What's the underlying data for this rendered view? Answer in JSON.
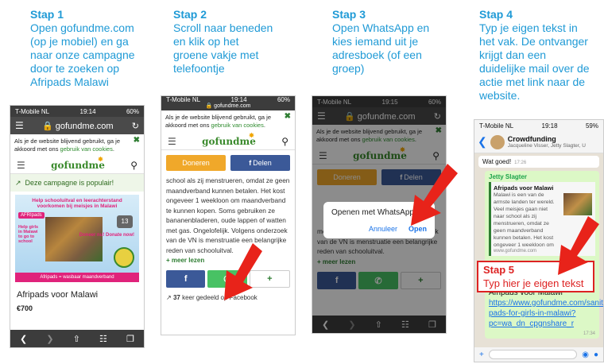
{
  "steps": [
    {
      "num": "Stap 1",
      "text": "Open gofundme.com\n(op je mobiel) en ga\nnaar onze campagne\ndoor te zoeken op\nAfripads Malawi"
    },
    {
      "num": "Stap 2",
      "text": "Scroll naar beneden\nen klik op het\ngroene vakje met\ntelefoontje"
    },
    {
      "num": "Stap 3",
      "text": "Open WhatsApp en\nkies iemand uit je\nadresboek (of een\ngroep)"
    },
    {
      "num": "Stap 4",
      "text": "Typ je eigen tekst in\nhet vak. De ontvanger\nkrijgt dan een\nduidelijke mail over de\nactie met link naar de\nwebsite."
    }
  ],
  "stap5": {
    "num": "Stap 5",
    "text": "Typ hier je eigen tekst"
  },
  "status": {
    "carrier": "T-Mobile NL",
    "time1": "19:14",
    "time2": "19:14",
    "time3": "19:15",
    "time4": "19:18",
    "battery": "60%",
    "battery4": "59%"
  },
  "browser": {
    "url": "gofundme.com",
    "url_small": "gofundme.com"
  },
  "cookie": {
    "text": "Als je de website blijvend gebruikt, ga je akkoord met ons ",
    "link": "gebruik van cookies",
    "end": "."
  },
  "logo": "gofundme",
  "phone1": {
    "popular": "Deze campagne is populair!",
    "banner_title": "Help schooluitval en leerachterstand voorkomen bij meisjes in Malawi",
    "afripads": "AFRIpads",
    "help_text": "Help girls in Malawi to go to school",
    "badge": "13",
    "donate": "Doneer nu! Donate now!",
    "footer": "Afripads = wasbaar maandverband",
    "title": "Afripads voor Malawi",
    "amount": "€700"
  },
  "phone2": {
    "donate_btn": "Doneren",
    "share_btn": "Delen",
    "story": "school als zij menstrueren, omdat ze geen maandverband kunnen betalen. Het kost ongeveer 1 weekloon om maandverband te kunnen kopen. Soms gebruiken ze bananenbladeren, oude lappen of watten met gas. Ongelofelijk. Volgens onderzoek van de VN is menstruatie een belangrijke reden van schooluitval.",
    "more": "+ meer lezen",
    "shared_count": "37",
    "shared_text": " keer gedeeld op Facebook"
  },
  "phone3": {
    "story": "met gas. Ongelofelijk. Volgens onderzoek van de VN is menstruatie een belangrijke reden van schooluitval.",
    "dialog_title": "Openen met WhatsApp?",
    "cancel": "Annuleer",
    "open": "Open",
    "donate_btn": "Doneren",
    "share_btn": "Delen",
    "more": "+ meer lezen"
  },
  "phone4": {
    "chat_name": "Crowdfunding",
    "chat_members": "Jacqueline Visser, Jetty Slagter, U",
    "prev_msg": "Wat goed!",
    "prev_time": "17:26",
    "sender": "Jetty Slagter",
    "preview_title": "Afripads voor Malawi",
    "preview_desc": "Malawi is een van de armste landen ter wereld. Veel meisjes gaan niet naar school als zij menstrueren, omdat ze geen maandverband kunnen betalen. Het kost ongeveer 1 weekloon om maandverband te kunnen kopen. Soms gebruiken ze bananenbladeren,",
    "preview_url": "www.gofundme.com",
    "msg_text": "Afripads voor Malawi ",
    "msg_link": "https://www.gofundme.com/sanitary-pads-for-girls-in-malawi?pc=wa_dn_cpgnshare_r",
    "msg_time": "17:34"
  },
  "colors": {
    "step_blue": "#1f9ad6",
    "gofundme_green": "#3a8a2c",
    "donate_orange": "#f0a82a",
    "facebook_blue": "#3b5998",
    "whatsapp_green": "#48c264",
    "arrow_red": "#e8231a"
  },
  "icons": [
    "hamburger-icon",
    "lock-icon",
    "refresh-icon",
    "close-icon",
    "search-icon",
    "trend-icon",
    "facebook-icon",
    "whatsapp-icon",
    "plus-icon",
    "back-icon",
    "forward-icon",
    "share-icon",
    "bookmarks-icon",
    "tabs-icon",
    "camera-icon",
    "mic-icon"
  ]
}
